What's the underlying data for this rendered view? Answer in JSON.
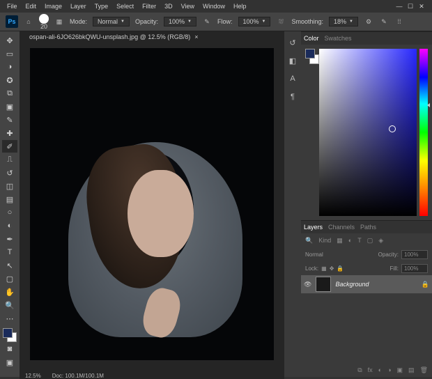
{
  "menu": [
    "File",
    "Edit",
    "Image",
    "Layer",
    "Type",
    "Select",
    "Filter",
    "3D",
    "View",
    "Window",
    "Help"
  ],
  "opt": {
    "brush_size": "20",
    "mode_label": "Mode:",
    "mode": "Normal",
    "opacity_label": "Opacity:",
    "opacity": "100%",
    "flow_label": "Flow:",
    "flow": "100%",
    "smoothing_label": "Smoothing:",
    "smoothing": "18%"
  },
  "tab": {
    "name": "ospan-ali-6JO626bkQWU-unsplash.jpg @ 12.5% (RGB/8)"
  },
  "status": {
    "zoom": "12.5%",
    "doc_label": "Doc:",
    "doc": "100.1M/100.1M"
  },
  "panels": {
    "color_tab": "Color",
    "swatches_tab": "Swatches",
    "layers_tab": "Layers",
    "channels_tab": "Channels",
    "paths_tab": "Paths"
  },
  "layers": {
    "kind": "Kind",
    "blend": "Normal",
    "opacity_label": "Opacity:",
    "opacity": "100%",
    "lock_label": "Lock:",
    "fill_label": "Fill:",
    "fill": "100%",
    "layer0": "Background"
  }
}
